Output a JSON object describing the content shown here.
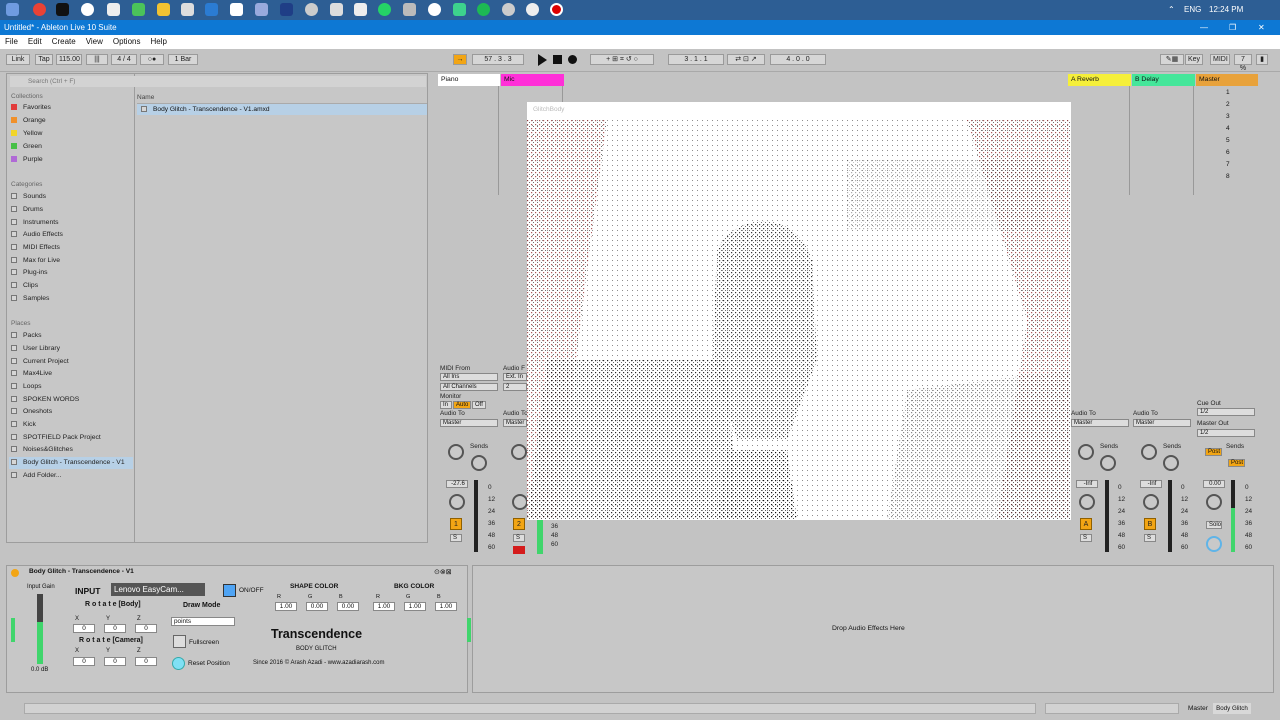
{
  "taskbar": {
    "language": "ENG",
    "time": "12:24 PM"
  },
  "window": {
    "title": "Untitled* - Ableton Live 10 Suite"
  },
  "menu": [
    "File",
    "Edit",
    "Create",
    "View",
    "Options",
    "Help"
  ],
  "control_bar": {
    "link": "Link",
    "tap": "Tap",
    "tempo": "115.00",
    "time_sig": "4 / 4",
    "quant": "1 Bar",
    "position": "57 . 3 . 3",
    "loop_start": "3 . 1 . 1",
    "loop_len": "4 . 0 . 0",
    "key": "Key",
    "midi": "MIDI",
    "cpu": "7 %"
  },
  "browser": {
    "search_placeholder": "Search (Ctrl + F)",
    "collections_title": "Collections",
    "collections": [
      {
        "label": "Favorites",
        "color": "#e23c3c"
      },
      {
        "label": "Orange",
        "color": "#f0902a"
      },
      {
        "label": "Yellow",
        "color": "#f2d52a"
      },
      {
        "label": "Green",
        "color": "#46c046"
      },
      {
        "label": "Purple",
        "color": "#b06ad6"
      }
    ],
    "categories_title": "Categories",
    "categories": [
      "Sounds",
      "Drums",
      "Instruments",
      "Audio Effects",
      "MIDI Effects",
      "Max for Live",
      "Plug-ins",
      "Clips",
      "Samples"
    ],
    "places_title": "Places",
    "places": [
      "Packs",
      "User Library",
      "Current Project",
      "Max4Live",
      "Loops",
      "SPOKEN WORDS",
      "Oneshots",
      "Kick",
      "SPOTFIELD Pack Project",
      "Noises&Glitches",
      "Body Glitch - Transcendence - V1",
      "Add Folder..."
    ],
    "name_header": "Name",
    "file": "Body Glitch - Transcendence - V1.amxd"
  },
  "tracks": [
    {
      "name": "Piano",
      "color": "#ffffff"
    },
    {
      "name": "Mic",
      "color": "#ff2fd8"
    },
    {
      "name": "A Reverb",
      "color": "#f5ef3a"
    },
    {
      "name": "B Delay",
      "color": "#45e69a"
    },
    {
      "name": "Master",
      "color": "#e8a23b"
    }
  ],
  "scene_numbers": [
    "1",
    "2",
    "3",
    "4",
    "5",
    "6",
    "7",
    "8"
  ],
  "io": {
    "midi_from": "MIDI From",
    "all_ins": "All Ins",
    "all_channels": "All Channels",
    "monitor": "Monitor",
    "in": "In",
    "auto": "Auto",
    "off": "Off",
    "audio_to": "Audio To",
    "master": "Master",
    "audio_from": "Audio F",
    "ext_in": "Ext. In",
    "two": "2",
    "cue_out": "Cue Out",
    "cue_val": "1/2",
    "master_out": "Master Out",
    "sends": "Sends",
    "post": "Post"
  },
  "mixer": {
    "vol1": "-27.6",
    "vol_inf1": "-Inf",
    "vol_inf2": "-Inf",
    "vol_master": "0.00",
    "ticks": [
      "0",
      "12",
      "24",
      "36",
      "48",
      "60"
    ],
    "t1": "1",
    "t2": "2",
    "tA": "A",
    "tB": "B",
    "solo": "S",
    "solo_m": "Solo"
  },
  "video": {
    "window_title": "GlitchBody"
  },
  "device": {
    "title": "Body Glitch - Transcendence - V1",
    "input_gain": "Input Gain",
    "gain_db": "0.0 dB",
    "input_label": "INPUT",
    "camera": "Lenovo EasyCam...",
    "onoff": "ON/OFF",
    "rotate_body": "R o t a t e  [Body]",
    "rotate_camera": "R o t a t e  [Camera]",
    "axes": [
      "X",
      "Y",
      "Z"
    ],
    "zero": "0",
    "draw_mode": "Draw Mode",
    "draw_value": "points",
    "fullscreen": "Fullscreen",
    "reset": "Reset Position",
    "shape_color": "SHAPE COLOR",
    "bkg_color": "BKG COLOR",
    "rgb": [
      "R",
      "G",
      "B"
    ],
    "shape_vals": [
      "1.00",
      "0.00",
      "0.00"
    ],
    "bkg_vals": [
      "1.00",
      "1.00",
      "1.00"
    ],
    "product": "Transcendence",
    "sub": "BODY GLITCH",
    "credit": "Since 2016 © Arash Azadi - www.azadiarash.com"
  },
  "drop_effects": "Drop Audio Effects Here",
  "statusbar": {
    "master": "Master",
    "track": "Body Glitch"
  },
  "colors": {
    "accent": "#f2a514",
    "mic": "#ff2fd8",
    "reverb": "#f5ef3a",
    "delay": "#45e69a",
    "titlebar": "#0d78d4"
  }
}
